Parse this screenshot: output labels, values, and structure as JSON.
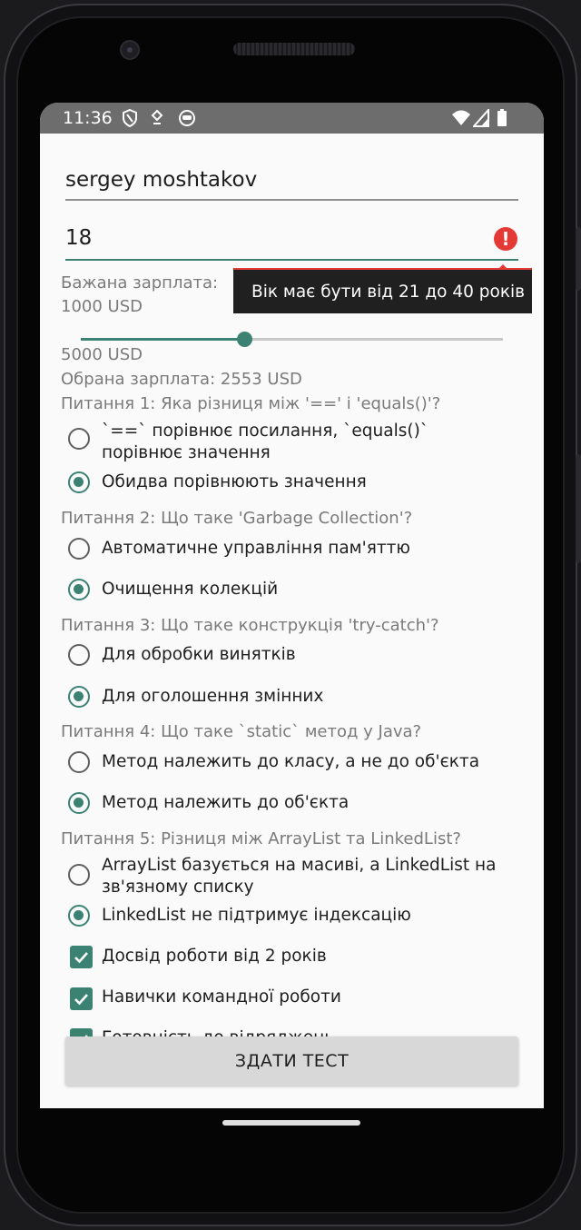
{
  "status_bar": {
    "time": "11:36"
  },
  "form": {
    "name_value": "sergey moshtakov",
    "age_value": "18",
    "age_error": "Вік має бути від 21 до 40 років",
    "salary_label": "Бажана зарплата:",
    "salary_min": "1000 USD",
    "salary_max": "5000 USD",
    "salary_selected": "Обрана зарплата: 2553 USD",
    "salary_slider_fraction": 0.388
  },
  "questions": [
    {
      "text": "Питання 1: Яка різниця між '==' і 'equals()'?",
      "options": [
        "`==` порівнює посилання, `equals()` порівнює значення",
        "Обидва порівнюють значення"
      ],
      "selected": 1
    },
    {
      "text": "Питання 2: Що таке 'Garbage Collection'?",
      "options": [
        "Автоматичне управління пам'яттю",
        "Очищення колекцій"
      ],
      "selected": 1
    },
    {
      "text": "Питання 3: Що таке конструкція 'try-catch'?",
      "options": [
        "Для обробки винятків",
        "Для оголошення змінних"
      ],
      "selected": 1
    },
    {
      "text": "Питання 4: Що таке `static` метод у Java?",
      "options": [
        "Метод належить до класу, а не до об'єкта",
        "Метод належить до об'єкта"
      ],
      "selected": 1
    },
    {
      "text": "Питання 5: Різниця між ArrayList та LinkedList?",
      "options": [
        "ArrayList базується на масиві, а LinkedList на зв'язному списку",
        "LinkedList не підтримує індексацію"
      ],
      "selected": 1
    }
  ],
  "checkboxes": [
    {
      "label": "Досвід роботи від 2 років",
      "checked": true
    },
    {
      "label": "Навички командної роботи",
      "checked": true
    },
    {
      "label": "Готовність до відряджень",
      "checked": true
    }
  ],
  "submit_label": "ЗДАТИ ТЕСТ",
  "colors": {
    "accent": "#3b8273",
    "error": "#e53935"
  }
}
